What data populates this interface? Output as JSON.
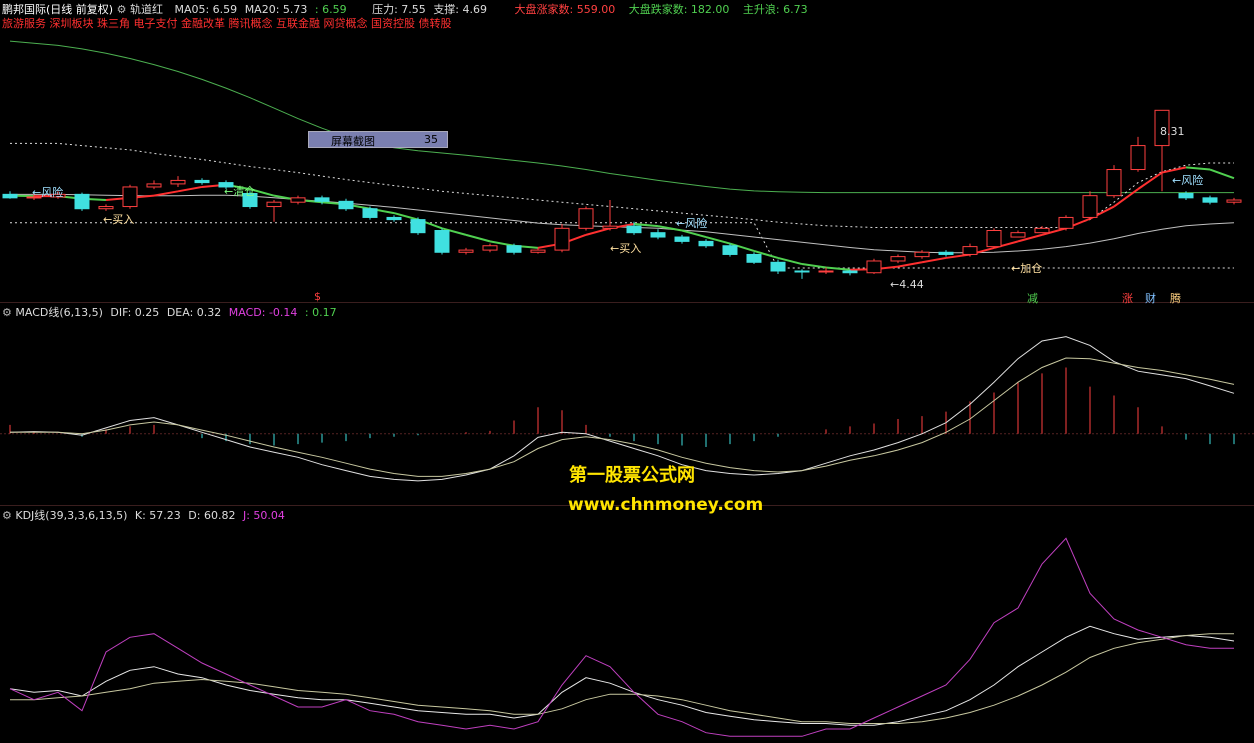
{
  "header": {
    "stock": "鹏邦国际(日线 前复权)",
    "indicator": "轨道红",
    "ma05": "MA05: 6.59",
    "ma20": "MA20: 5.73",
    "v3": ": 6.59",
    "pressure": "压力: 7.55",
    "support": "支撑: 4.69",
    "up_count": "大盘涨家数: 559.00",
    "down_count": "大盘跌家数: 182.00",
    "main_up": "主升浪: 6.73",
    "concepts": "旅游服务 深圳板块 珠三角 电子支付 金融改革 腾讯概念 互联金融 网贷概念 国资控股 债转股"
  },
  "screenshot_box": {
    "label": "屏幕截图",
    "value": "35"
  },
  "annotations": {
    "risk": "←风险",
    "buy": "←买入",
    "clear": "←清仓",
    "add": "←加仓",
    "high_label": "8.31",
    "low_label": "←4.44",
    "s_mark": "$",
    "mark_jian": "减",
    "mark_zhang": "涨",
    "mark_cai": "财",
    "mark_sheng": "腾"
  },
  "macd_header": {
    "name": "MACD线(6,13,5)",
    "dif": "DIF: 0.25",
    "dea": "DEA: 0.32",
    "macd": "MACD: -0.14",
    "v4": ": 0.17"
  },
  "kdj_header": {
    "name": "KDJ线(39,3,3,6,13,5)",
    "k": "K: 57.23",
    "d": "D: 60.82",
    "j": "J: 50.04"
  },
  "watermark": {
    "line1": "第一股票公式网",
    "line2": "www.chnmoney.com"
  },
  "colors": {
    "up": "#ff4040",
    "down": "#40e0e0",
    "ma_green": "#50d050",
    "ma_red": "#ff3030",
    "upper_band": "#4caf50",
    "dif": "#e0e0e0",
    "dea": "#c8c8a0",
    "j": "#c040c0",
    "yellow": "#ffe400"
  },
  "chart_data": [
    {
      "type": "candlestick",
      "title": "",
      "x": [
        0,
        1,
        2,
        3,
        4,
        5,
        6,
        7,
        8,
        9,
        10,
        11,
        12,
        13,
        14,
        15,
        16,
        17,
        18,
        19,
        20,
        21,
        22,
        23,
        24,
        25,
        26,
        27,
        28,
        29,
        30,
        31,
        32,
        33,
        34,
        35,
        36,
        37,
        38,
        39,
        40,
        41,
        42,
        43,
        44,
        45,
        46,
        47,
        48,
        49,
        50,
        51
      ],
      "open": [
        6.38,
        6.3,
        6.32,
        6.38,
        6.05,
        6.1,
        6.55,
        6.62,
        6.7,
        6.65,
        6.4,
        6.1,
        6.2,
        6.3,
        6.22,
        6.05,
        5.85,
        5.8,
        5.55,
        5.05,
        5.1,
        5.2,
        5.05,
        5.1,
        5.6,
        5.6,
        5.65,
        5.5,
        5.4,
        5.3,
        5.2,
        5.0,
        4.82,
        4.62,
        4.6,
        4.62,
        4.58,
        4.85,
        4.95,
        5.05,
        5.0,
        5.18,
        5.4,
        5.5,
        5.6,
        5.85,
        6.35,
        6.95,
        7.5,
        6.4,
        6.3,
        6.2
      ],
      "close": [
        6.3,
        6.32,
        6.38,
        6.05,
        6.1,
        6.55,
        6.62,
        6.7,
        6.65,
        6.55,
        6.1,
        6.2,
        6.3,
        6.22,
        6.05,
        5.85,
        5.8,
        5.5,
        5.05,
        5.1,
        5.2,
        5.05,
        5.1,
        5.6,
        6.05,
        5.65,
        5.5,
        5.4,
        5.3,
        5.2,
        5.0,
        4.82,
        4.62,
        4.6,
        4.62,
        4.58,
        4.85,
        4.95,
        5.05,
        5.0,
        5.18,
        5.55,
        5.5,
        5.6,
        5.85,
        6.35,
        6.95,
        7.5,
        8.31,
        6.3,
        6.2,
        6.25
      ],
      "high": [
        6.45,
        6.4,
        6.45,
        6.42,
        6.15,
        6.6,
        6.7,
        6.8,
        6.75,
        6.7,
        6.45,
        6.25,
        6.35,
        6.35,
        6.28,
        6.1,
        5.9,
        5.85,
        5.6,
        5.15,
        5.25,
        5.25,
        5.15,
        5.7,
        6.1,
        6.25,
        5.75,
        5.58,
        5.45,
        5.35,
        5.25,
        5.05,
        4.88,
        4.66,
        4.7,
        4.65,
        4.9,
        5.0,
        5.1,
        5.1,
        5.25,
        5.6,
        5.55,
        5.65,
        5.9,
        6.45,
        7.05,
        7.7,
        8.31,
        6.45,
        6.35,
        6.3
      ],
      "low": [
        6.28,
        6.25,
        6.28,
        6.0,
        6.0,
        6.05,
        6.5,
        6.55,
        6.6,
        6.5,
        6.05,
        5.75,
        6.15,
        6.15,
        6.0,
        5.8,
        5.75,
        5.45,
        5.0,
        5.0,
        5.05,
        5.0,
        5.02,
        5.05,
        5.55,
        5.55,
        5.45,
        5.35,
        5.25,
        5.15,
        4.95,
        4.78,
        4.55,
        4.44,
        4.55,
        4.52,
        4.55,
        4.8,
        4.9,
        4.95,
        4.95,
        5.15,
        5.45,
        5.5,
        5.55,
        5.8,
        6.3,
        6.9,
        6.45,
        6.25,
        6.15,
        6.15
      ],
      "ma05": [
        6.35,
        6.34,
        6.34,
        6.28,
        6.25,
        6.3,
        6.35,
        6.45,
        6.55,
        6.6,
        6.5,
        6.35,
        6.25,
        6.2,
        6.15,
        6.05,
        5.95,
        5.8,
        5.6,
        5.45,
        5.3,
        5.2,
        5.15,
        5.25,
        5.45,
        5.6,
        5.7,
        5.65,
        5.55,
        5.4,
        5.25,
        5.08,
        4.92,
        4.78,
        4.7,
        4.65,
        4.66,
        4.72,
        4.82,
        4.92,
        5.0,
        5.15,
        5.3,
        5.45,
        5.6,
        5.82,
        6.1,
        6.5,
        6.88,
        7.0,
        6.95,
        6.75
      ],
      "ma_slow": [
        6.38,
        6.38,
        6.38,
        6.37,
        6.36,
        6.35,
        6.35,
        6.35,
        6.36,
        6.36,
        6.34,
        6.3,
        6.26,
        6.22,
        6.18,
        6.13,
        6.08,
        6.02,
        5.96,
        5.9,
        5.84,
        5.78,
        5.72,
        5.68,
        5.66,
        5.64,
        5.62,
        5.6,
        5.56,
        5.52,
        5.46,
        5.4,
        5.34,
        5.28,
        5.22,
        5.16,
        5.11,
        5.08,
        5.05,
        5.04,
        5.04,
        5.05,
        5.08,
        5.12,
        5.18,
        5.26,
        5.36,
        5.48,
        5.58,
        5.66,
        5.7,
        5.73
      ],
      "upper_band": [
        9.9,
        9.85,
        9.8,
        9.72,
        9.62,
        9.5,
        9.36,
        9.2,
        9.02,
        8.82,
        8.6,
        8.36,
        8.12,
        7.9,
        7.7,
        7.55,
        7.45,
        7.38,
        7.33,
        7.28,
        7.22,
        7.16,
        7.1,
        7.03,
        6.95,
        6.86,
        6.78,
        6.7,
        6.63,
        6.56,
        6.5,
        6.46,
        6.44,
        6.43,
        6.42,
        6.42,
        6.42,
        6.42,
        6.42,
        6.42,
        6.42,
        6.42,
        6.42,
        6.42,
        6.42,
        6.42,
        6.42,
        6.42,
        6.42,
        6.42,
        6.42,
        6.42
      ],
      "pressure": [
        7.55,
        7.55,
        7.55,
        7.5,
        7.45,
        7.4,
        7.32,
        7.25,
        7.18,
        7.1,
        7.02,
        6.95,
        6.88,
        6.8,
        6.72,
        6.65,
        6.58,
        6.52,
        6.45,
        6.4,
        6.35,
        6.3,
        6.25,
        6.2,
        6.15,
        6.1,
        6.05,
        6.0,
        5.95,
        5.9,
        5.85,
        5.8,
        5.74,
        5.7,
        5.66,
        5.64,
        5.62,
        5.62,
        5.62,
        5.62,
        5.62,
        5.62,
        5.62,
        5.62,
        5.62,
        5.8,
        6.2,
        6.65,
        6.9,
        7.05,
        7.1,
        7.1
      ],
      "support": [
        5.73,
        5.73,
        5.73,
        5.73,
        5.73,
        5.73,
        5.73,
        5.73,
        5.73,
        5.73,
        5.73,
        5.73,
        5.73,
        5.73,
        5.73,
        5.73,
        5.73,
        5.73,
        5.73,
        5.73,
        5.73,
        5.73,
        5.73,
        5.73,
        5.73,
        5.73,
        5.73,
        5.73,
        5.73,
        5.73,
        5.73,
        5.73,
        4.69,
        4.69,
        4.69,
        4.69,
        4.69,
        4.69,
        4.69,
        4.69,
        4.69,
        4.69,
        4.69,
        4.69,
        4.69,
        4.69,
        4.69,
        4.69,
        4.69,
        4.69,
        4.69,
        4.69
      ],
      "ylim": [
        4.0,
        10.2
      ]
    },
    {
      "type": "line",
      "title": "MACD线(6,13,5)",
      "x": [
        0,
        1,
        2,
        3,
        4,
        5,
        6,
        7,
        8,
        9,
        10,
        11,
        12,
        13,
        14,
        15,
        16,
        17,
        18,
        19,
        20,
        21,
        22,
        23,
        24,
        25,
        26,
        27,
        28,
        29,
        30,
        31,
        32,
        33,
        34,
        35,
        36,
        37,
        38,
        39,
        40,
        41,
        42,
        43,
        44,
        45,
        46,
        47,
        48,
        49,
        50,
        51
      ],
      "series": [
        {
          "name": "DIF",
          "values": [
            0.02,
            0.03,
            0.02,
            -0.02,
            0.08,
            0.18,
            0.22,
            0.12,
            0.02,
            -0.08,
            -0.18,
            -0.25,
            -0.32,
            -0.42,
            -0.5,
            -0.58,
            -0.62,
            -0.64,
            -0.62,
            -0.56,
            -0.48,
            -0.3,
            -0.05,
            0.02,
            0.0,
            -0.1,
            -0.2,
            -0.3,
            -0.42,
            -0.5,
            -0.54,
            -0.56,
            -0.54,
            -0.5,
            -0.4,
            -0.3,
            -0.22,
            -0.12,
            0.0,
            0.15,
            0.4,
            0.7,
            1.02,
            1.26,
            1.32,
            1.2,
            0.98,
            0.85,
            0.8,
            0.75,
            0.65,
            0.55
          ]
        },
        {
          "name": "DEA",
          "values": [
            0.02,
            0.02,
            0.02,
            0.0,
            0.05,
            0.12,
            0.16,
            0.12,
            0.05,
            -0.02,
            -0.1,
            -0.18,
            -0.25,
            -0.32,
            -0.4,
            -0.48,
            -0.54,
            -0.58,
            -0.58,
            -0.54,
            -0.48,
            -0.38,
            -0.2,
            -0.08,
            -0.04,
            -0.08,
            -0.14,
            -0.22,
            -0.32,
            -0.4,
            -0.46,
            -0.5,
            -0.52,
            -0.5,
            -0.44,
            -0.36,
            -0.3,
            -0.22,
            -0.12,
            0.02,
            0.2,
            0.45,
            0.7,
            0.9,
            1.03,
            1.02,
            0.96,
            0.9,
            0.86,
            0.8,
            0.74,
            0.67
          ]
        },
        {
          "name": "MACD",
          "values": [
            0.12,
            0.02,
            0.0,
            -0.04,
            0.06,
            0.1,
            0.12,
            0.0,
            -0.06,
            -0.1,
            -0.14,
            -0.16,
            -0.14,
            -0.12,
            -0.1,
            -0.06,
            -0.04,
            -0.02,
            0.0,
            0.02,
            0.04,
            0.18,
            0.36,
            0.32,
            0.12,
            -0.04,
            -0.1,
            -0.14,
            -0.16,
            -0.18,
            -0.14,
            -0.1,
            -0.04,
            0.0,
            0.06,
            0.1,
            0.14,
            0.2,
            0.24,
            0.3,
            0.44,
            0.56,
            0.7,
            0.82,
            0.9,
            0.64,
            0.52,
            0.36,
            0.1,
            -0.08,
            -0.14,
            -0.14
          ]
        }
      ],
      "ylim": [
        -0.9,
        1.6
      ]
    },
    {
      "type": "line",
      "title": "KDJ线(39,3,3,6,13,5)",
      "x": [
        0,
        1,
        2,
        3,
        4,
        5,
        6,
        7,
        8,
        9,
        10,
        11,
        12,
        13,
        14,
        15,
        16,
        17,
        18,
        19,
        20,
        21,
        22,
        23,
        24,
        25,
        26,
        27,
        28,
        29,
        30,
        31,
        32,
        33,
        34,
        35,
        36,
        37,
        38,
        39,
        40,
        41,
        42,
        43,
        44,
        45,
        46,
        47,
        48,
        49,
        50,
        51
      ],
      "series": [
        {
          "name": "K",
          "values": [
            28,
            26,
            27,
            24,
            32,
            38,
            40,
            36,
            34,
            30,
            27,
            25,
            23,
            22,
            22,
            20,
            18,
            16,
            15,
            14,
            14,
            12,
            14,
            26,
            34,
            31,
            26,
            22,
            19,
            15,
            13,
            11,
            10,
            9,
            9,
            8,
            8,
            10,
            13,
            16,
            22,
            30,
            40,
            48,
            56,
            62,
            58,
            55,
            56,
            57,
            56,
            54
          ]
        },
        {
          "name": "D",
          "values": [
            22,
            22,
            23,
            24,
            26,
            28,
            31,
            32,
            33,
            32,
            31,
            29,
            27,
            26,
            25,
            23,
            21,
            19,
            18,
            17,
            16,
            14,
            14,
            17,
            22,
            25,
            25,
            24,
            22,
            19,
            16,
            14,
            12,
            10,
            10,
            9,
            9,
            9,
            10,
            12,
            15,
            19,
            24,
            30,
            37,
            45,
            50,
            53,
            55,
            57,
            58,
            58
          ]
        },
        {
          "name": "J",
          "values": [
            28,
            22,
            26,
            16,
            48,
            56,
            58,
            50,
            42,
            36,
            30,
            24,
            18,
            18,
            22,
            16,
            14,
            10,
            8,
            6,
            8,
            6,
            10,
            30,
            46,
            40,
            26,
            14,
            10,
            4,
            2,
            2,
            2,
            2,
            6,
            6,
            12,
            18,
            24,
            30,
            44,
            64,
            72,
            96,
            110,
            80,
            66,
            60,
            56,
            52,
            50,
            50
          ]
        }
      ],
      "ylim": [
        0,
        120
      ]
    }
  ]
}
